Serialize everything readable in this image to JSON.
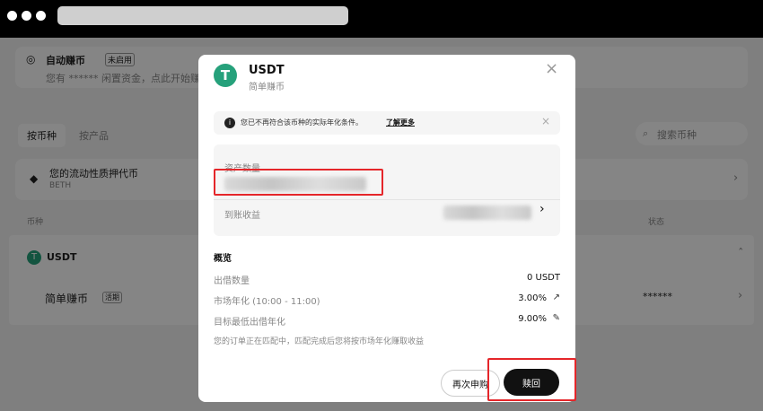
{
  "browser": {
    "dots": 3
  },
  "background": {
    "auto_earn": {
      "title": "自动赚币",
      "badge": "未启用",
      "subtitle": "您有 ****** 闲置资金，点此开始赚"
    },
    "tabs": [
      {
        "label": "按币种"
      },
      {
        "label": "按产品"
      }
    ],
    "search_placeholder": "搜索币种",
    "liquidity": {
      "title": "您的流动性质押代币",
      "subtitle": "BETH"
    },
    "table_headers": {
      "coin": "币种",
      "status": "状态"
    },
    "usdt_row": {
      "label": "USDT"
    },
    "simple_row": {
      "label": "简单赚币",
      "badge": "活期",
      "value": "******"
    }
  },
  "modal": {
    "coin": "USDT",
    "subtitle": "简单赚币",
    "notice": {
      "text": "您已不再符合该币种的实际年化条件。",
      "link": "了解更多"
    },
    "asset_label": "资产数量",
    "earnings_label": "到账收益",
    "overview": {
      "title": "概览",
      "rows": [
        {
          "label": "出借数量",
          "value": "0 USDT"
        },
        {
          "label": "市场年化 (10:00 - 11:00)",
          "value": "3.00%"
        },
        {
          "label": "目标最低出借年化",
          "value": "9.00%"
        }
      ],
      "note": "您的订单正在匹配中，匹配完成后您将按市场年化赚取收益"
    },
    "buttons": {
      "resubscribe": "再次申购",
      "redeem": "赎回"
    }
  },
  "colors": {
    "accent": "#26a17b",
    "highlight": "#e5262a",
    "button_dark": "#111111"
  }
}
